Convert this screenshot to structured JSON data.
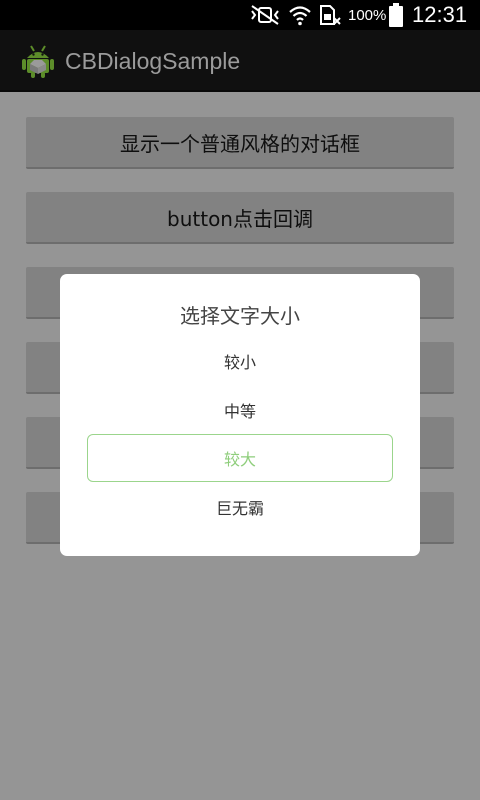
{
  "status_bar": {
    "icons": [
      "mute-vibrate-icon",
      "wifi-icon",
      "no-sim-icon",
      "battery-icon"
    ],
    "battery_percent": "100%",
    "time": "12:31"
  },
  "action_bar": {
    "app_icon": "android-robot-icon",
    "title": "CBDialogSample"
  },
  "buttons": [
    {
      "label": "显示一个普通风格的对话框"
    },
    {
      "label": "button点击回调"
    },
    {
      "label": ""
    },
    {
      "label": ""
    },
    {
      "label": ""
    },
    {
      "label": ""
    }
  ],
  "dialog": {
    "title": "选择文字大小",
    "options": [
      {
        "label": "较小",
        "selected": false
      },
      {
        "label": "中等",
        "selected": false
      },
      {
        "label": "较大",
        "selected": true
      },
      {
        "label": "巨无霸",
        "selected": false
      }
    ],
    "accent_color": "#8fce7c"
  },
  "colors": {
    "overlay_background": "#959595",
    "dialog_background": "#ffffff",
    "selected_border": "#9bd58c"
  }
}
